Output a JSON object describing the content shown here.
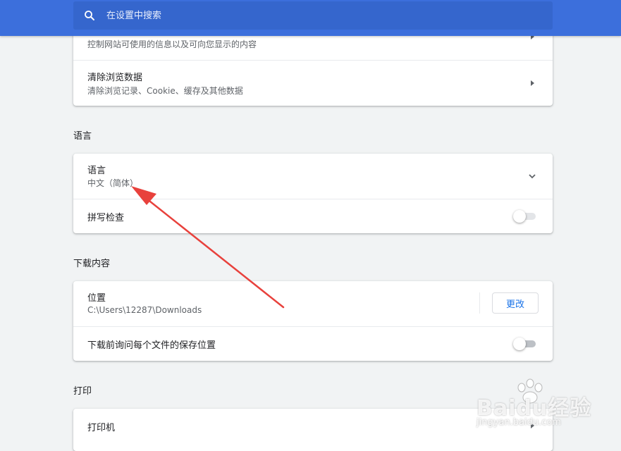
{
  "search": {
    "placeholder": "在设置中搜索"
  },
  "privacy": {
    "site_settings_sub": "控制网站可使用的信息以及可向您显示的内容",
    "clear_data_title": "清除浏览数据",
    "clear_data_sub": "清除浏览记录、Cookie、缓存及其他数据"
  },
  "languages": {
    "section_title": "语言",
    "language_title": "语言",
    "language_value": "中文（简体）",
    "spellcheck_label": "拼写检查",
    "spellcheck_on": false
  },
  "downloads": {
    "section_title": "下载内容",
    "location_title": "位置",
    "location_value": "C:\\Users\\12287\\Downloads",
    "change_button": "更改",
    "ask_label": "下载前询问每个文件的保存位置",
    "ask_on": false
  },
  "printing": {
    "section_title": "打印",
    "printers_label": "打印机"
  },
  "watermark": {
    "brand": "Baidu经验",
    "url": "jingyan.baidu.com"
  },
  "colors": {
    "header_blue": "#3c6fdc",
    "search_blue": "#3566cd",
    "annotation_red": "#e8413c",
    "link_blue": "#1a73e8"
  }
}
